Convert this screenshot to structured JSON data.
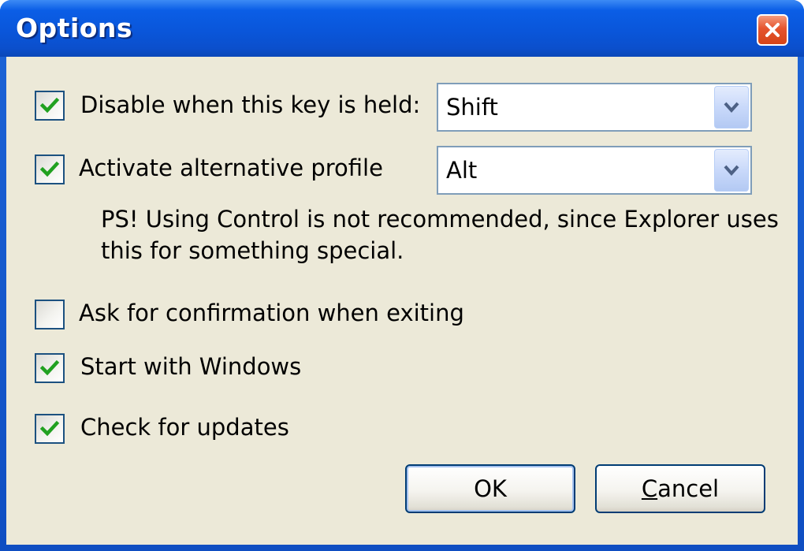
{
  "window": {
    "title": "Options",
    "close_label": "close"
  },
  "options": {
    "disable_key": {
      "label": "Disable when this key is held:",
      "checked": true,
      "selected": "Shift"
    },
    "alt_profile": {
      "label": "Activate alternative profile",
      "checked": true,
      "selected": "Alt"
    },
    "note_line1": "PS! Using Control is not recommended, since Explorer uses",
    "note_line2": "this for something special.",
    "confirm_exit": {
      "label": "Ask for confirmation when exiting",
      "checked": false
    },
    "start_windows": {
      "label": "Start with Windows",
      "checked": true
    },
    "check_updates": {
      "label": "Check for updates",
      "checked": true
    }
  },
  "buttons": {
    "ok": "OK",
    "cancel_first": "C",
    "cancel_rest": "ancel"
  },
  "colors": {
    "titlebar": "#0b5ee6",
    "client_bg": "#ece9d8",
    "checkmark": "#21a121",
    "close_button": "#e5542e"
  }
}
